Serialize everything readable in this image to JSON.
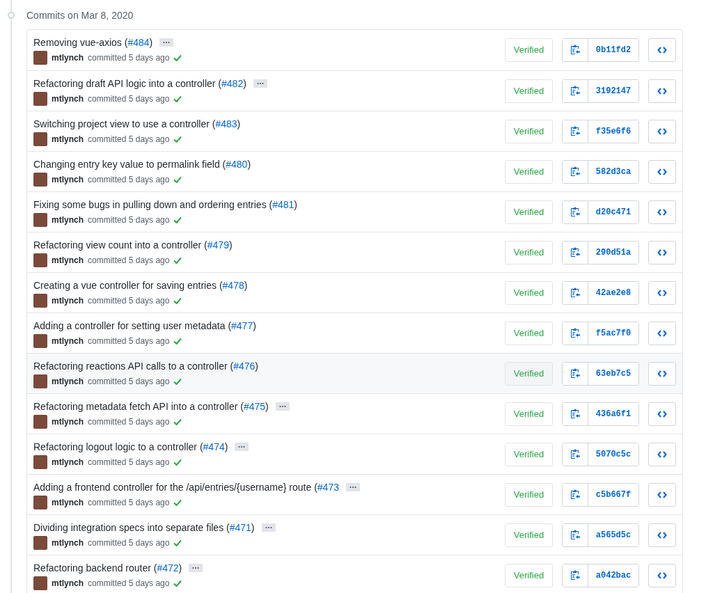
{
  "heading": "Commits on Mar 8, 2020",
  "commits": [
    {
      "title": "Removing vue-axios (",
      "pr": "#484",
      "suffix": ")",
      "more": true,
      "author": "mtlynch",
      "when": "committed 5 days ago",
      "verified": "Verified",
      "sha": "0b11fd2",
      "highlighted": false
    },
    {
      "title": "Refactoring draft API logic into a controller (",
      "pr": "#482",
      "suffix": ")",
      "more": true,
      "author": "mtlynch",
      "when": "committed 5 days ago",
      "verified": "Verified",
      "sha": "3192147",
      "highlighted": false
    },
    {
      "title": "Switching project view to use a controller (",
      "pr": "#483",
      "suffix": ")",
      "more": false,
      "author": "mtlynch",
      "when": "committed 5 days ago",
      "verified": "Verified",
      "sha": "f35e6f6",
      "highlighted": false
    },
    {
      "title": "Changing entry key value to permalink field (",
      "pr": "#480",
      "suffix": ")",
      "more": false,
      "author": "mtlynch",
      "when": "committed 5 days ago",
      "verified": "Verified",
      "sha": "582d3ca",
      "highlighted": false
    },
    {
      "title": "Fixing some bugs in pulling down and ordering entries (",
      "pr": "#481",
      "suffix": ")",
      "more": false,
      "author": "mtlynch",
      "when": "committed 5 days ago",
      "verified": "Verified",
      "sha": "d20c471",
      "highlighted": false
    },
    {
      "title": "Refactoring view count into a controller (",
      "pr": "#479",
      "suffix": ")",
      "more": false,
      "author": "mtlynch",
      "when": "committed 5 days ago",
      "verified": "Verified",
      "sha": "290d51a",
      "highlighted": false
    },
    {
      "title": "Creating a vue controller for saving entries (",
      "pr": "#478",
      "suffix": ")",
      "more": false,
      "author": "mtlynch",
      "when": "committed 5 days ago",
      "verified": "Verified",
      "sha": "42ae2e8",
      "highlighted": false
    },
    {
      "title": "Adding a controller for setting user metadata (",
      "pr": "#477",
      "suffix": ")",
      "more": false,
      "author": "mtlynch",
      "when": "committed 5 days ago",
      "verified": "Verified",
      "sha": "f5ac7f0",
      "highlighted": false
    },
    {
      "title": "Refactoring reactions API calls to a controller (",
      "pr": "#476",
      "suffix": ")",
      "more": false,
      "author": "mtlynch",
      "when": "committed 5 days ago",
      "verified": "Verified",
      "sha": "63eb7c5",
      "highlighted": true
    },
    {
      "title": "Refactoring metadata fetch API into a controller (",
      "pr": "#475",
      "suffix": ")",
      "more": true,
      "author": "mtlynch",
      "when": "committed 5 days ago",
      "verified": "Verified",
      "sha": "436a6f1",
      "highlighted": false
    },
    {
      "title": "Refactoring logout logic to a controller (",
      "pr": "#474",
      "suffix": ")",
      "more": true,
      "author": "mtlynch",
      "when": "committed 5 days ago",
      "verified": "Verified",
      "sha": "5070c5c",
      "highlighted": false
    },
    {
      "title": "Adding a frontend controller for the /api/entries/{username} route (",
      "pr": "#473",
      "more": true,
      "author": "mtlynch",
      "when": "committed 5 days ago",
      "verified": "Verified",
      "sha": "c5b667f",
      "highlighted": false
    },
    {
      "title": "Dividing integration specs into separate files (",
      "pr": "#471",
      "suffix": ")",
      "more": true,
      "author": "mtlynch",
      "when": "committed 5 days ago",
      "verified": "Verified",
      "sha": "a565d5c",
      "highlighted": false
    },
    {
      "title": "Refactoring backend router (",
      "pr": "#472",
      "suffix": ")",
      "more": true,
      "author": "mtlynch",
      "when": "committed 5 days ago",
      "verified": "Verified",
      "sha": "a042bac",
      "highlighted": false
    }
  ]
}
